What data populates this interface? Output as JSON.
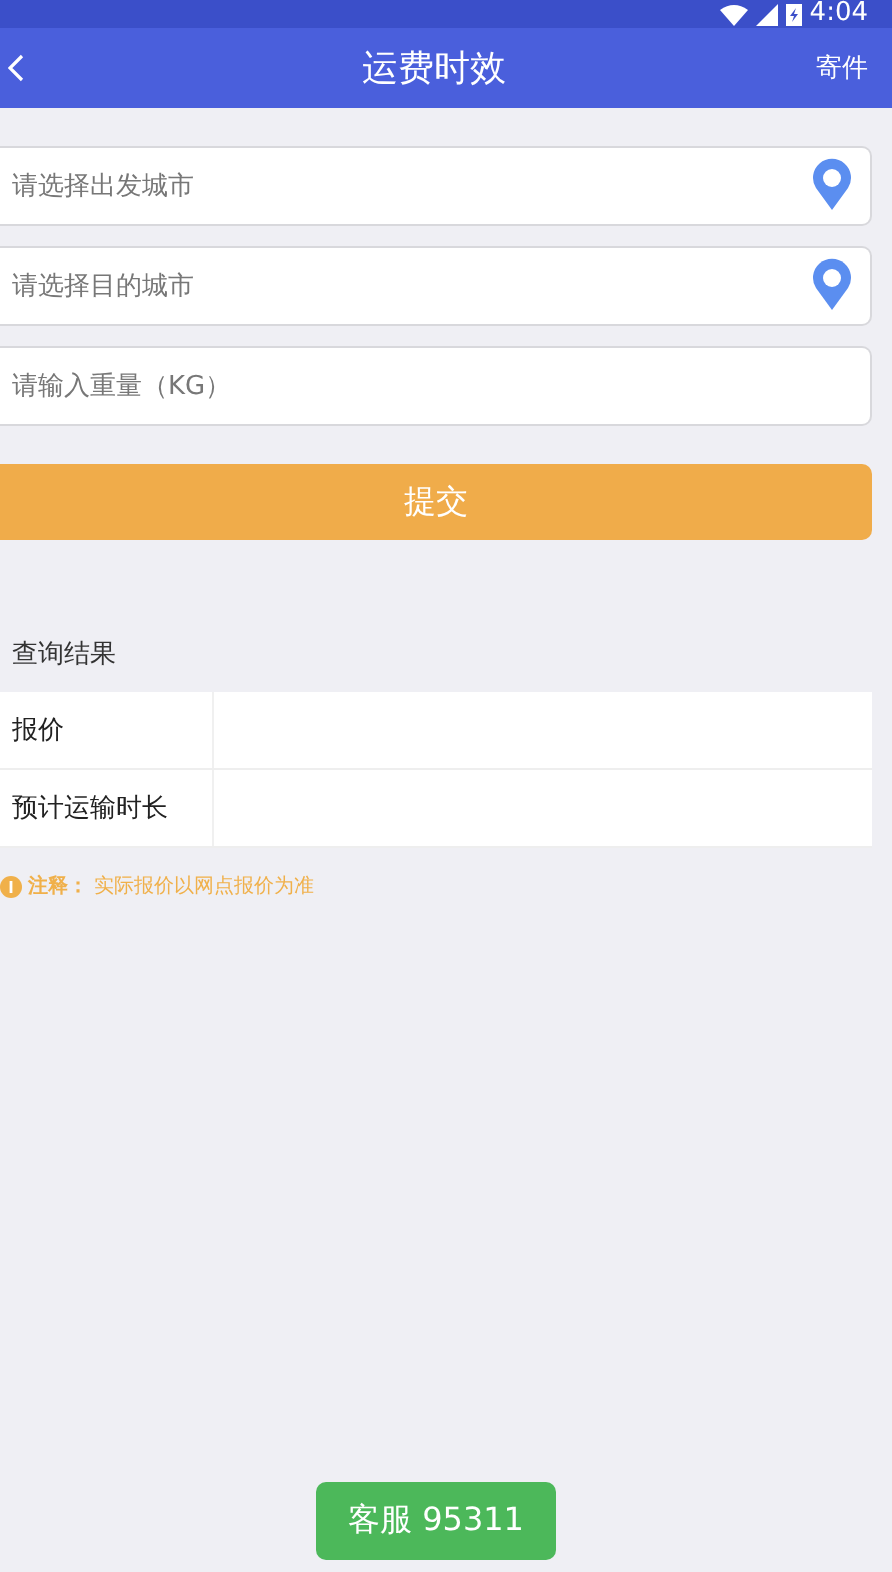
{
  "status_bar": {
    "time": "4:04"
  },
  "header": {
    "title": "运费时效",
    "action": "寄件"
  },
  "fields": [
    {
      "placeholder": "请选择出发城市",
      "kind": "location"
    },
    {
      "placeholder": "请选择目的城市",
      "kind": "location"
    },
    {
      "placeholder": "请输入重量（KG）",
      "kind": "text"
    }
  ],
  "submit": "提交",
  "results": {
    "title": "查询结果",
    "rows": [
      {
        "label": "报价"
      },
      {
        "label": "预计运输时长"
      }
    ]
  },
  "note": {
    "label": "注释：",
    "text": "实际报价以网点报价为准"
  },
  "service_button": "客服 95311"
}
